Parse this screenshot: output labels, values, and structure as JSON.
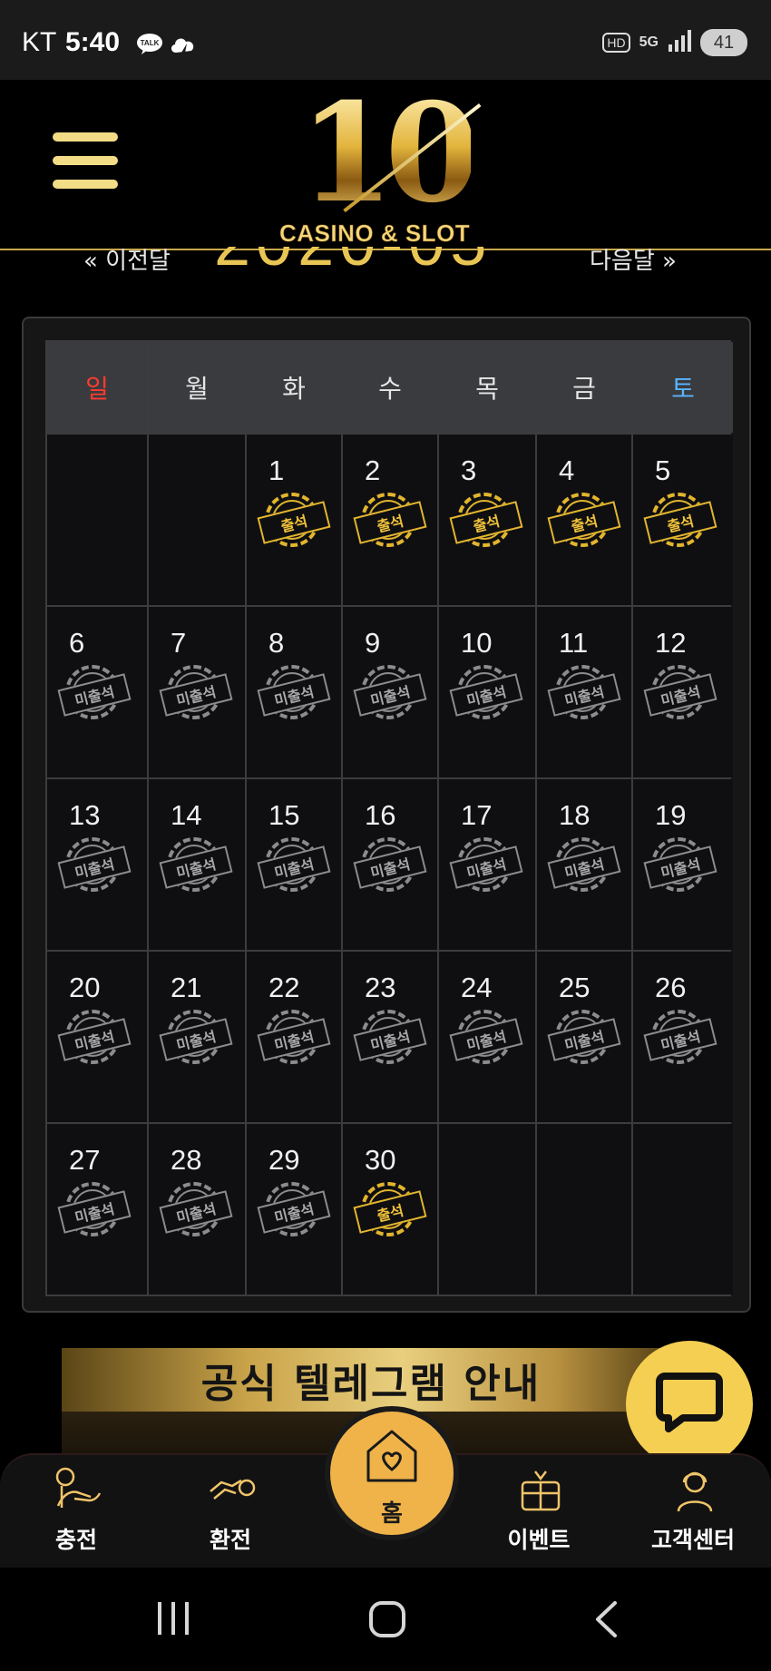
{
  "status_bar": {
    "carrier": "KT",
    "time": "5:40",
    "talk_label": "TALK",
    "network": "5G",
    "hd": "HD",
    "battery": "41"
  },
  "header": {
    "logo_number": "10",
    "logo_text": "CASINO & SLOT"
  },
  "calendar_nav": {
    "prev": "« 이전달",
    "month": "2020-05",
    "next": "다음달 »"
  },
  "weekdays": [
    "일",
    "월",
    "화",
    "수",
    "목",
    "금",
    "토"
  ],
  "stamp_labels": {
    "attended": "출석",
    "missed": "미출석"
  },
  "colors": {
    "gold": "#e2b52e",
    "sunday": "#ff3b30",
    "saturday": "#5ab4ff",
    "home_button": "#f0b34a",
    "chat_button": "#f4cf51"
  },
  "days": [
    {
      "day": "",
      "status": ""
    },
    {
      "day": "",
      "status": ""
    },
    {
      "day": "1",
      "status": "attended"
    },
    {
      "day": "2",
      "status": "attended"
    },
    {
      "day": "3",
      "status": "attended"
    },
    {
      "day": "4",
      "status": "attended"
    },
    {
      "day": "5",
      "status": "attended"
    },
    {
      "day": "6",
      "status": "missed"
    },
    {
      "day": "7",
      "status": "missed"
    },
    {
      "day": "8",
      "status": "missed"
    },
    {
      "day": "9",
      "status": "missed"
    },
    {
      "day": "10",
      "status": "missed"
    },
    {
      "day": "11",
      "status": "missed"
    },
    {
      "day": "12",
      "status": "missed"
    },
    {
      "day": "13",
      "status": "missed"
    },
    {
      "day": "14",
      "status": "missed"
    },
    {
      "day": "15",
      "status": "missed"
    },
    {
      "day": "16",
      "status": "missed"
    },
    {
      "day": "17",
      "status": "missed"
    },
    {
      "day": "18",
      "status": "missed"
    },
    {
      "day": "19",
      "status": "missed"
    },
    {
      "day": "20",
      "status": "missed"
    },
    {
      "day": "21",
      "status": "missed"
    },
    {
      "day": "22",
      "status": "missed"
    },
    {
      "day": "23",
      "status": "missed"
    },
    {
      "day": "24",
      "status": "missed"
    },
    {
      "day": "25",
      "status": "missed"
    },
    {
      "day": "26",
      "status": "missed"
    },
    {
      "day": "27",
      "status": "missed"
    },
    {
      "day": "28",
      "status": "missed"
    },
    {
      "day": "29",
      "status": "missed"
    },
    {
      "day": "30",
      "status": "attended"
    },
    {
      "day": "",
      "status": ""
    },
    {
      "day": "",
      "status": ""
    },
    {
      "day": "",
      "status": ""
    }
  ],
  "banner": {
    "title": "공식 텔레그램 안내"
  },
  "bottom_nav": {
    "charge": "충전",
    "exchange": "환전",
    "home": "홈",
    "event": "이벤트",
    "support": "고객센터"
  },
  "icons": {
    "menu": "hamburger-icon",
    "chat": "chat-bubble-icon",
    "home": "heart-house-icon",
    "charge": "hand-coin-icon",
    "exchange": "exchange-hand-icon",
    "event": "gift-icon",
    "support": "headset-agent-icon"
  }
}
